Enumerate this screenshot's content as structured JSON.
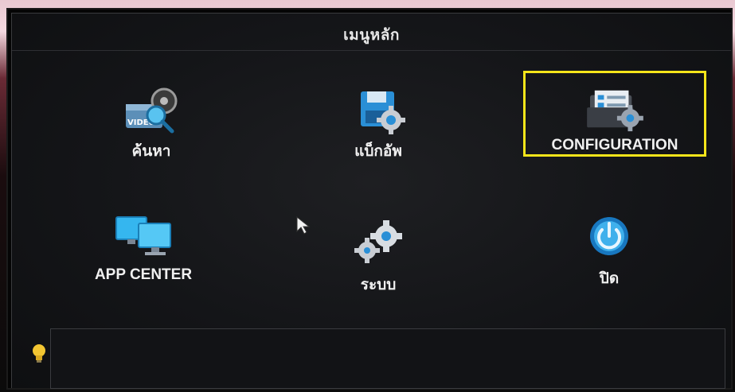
{
  "window": {
    "title": "เมนูหลัก"
  },
  "menu": {
    "items": [
      {
        "id": "search",
        "label": "ค้นหา",
        "icon": "video-search-icon"
      },
      {
        "id": "backup",
        "label": "แบ็กอัพ",
        "icon": "backup-gear-icon"
      },
      {
        "id": "configuration",
        "label": "CONFIGURATION",
        "icon": "folder-settings-icon",
        "selected": true
      },
      {
        "id": "app-center",
        "label": "APP CENTER",
        "icon": "monitors-icon"
      },
      {
        "id": "system",
        "label": "ระบบ",
        "icon": "gears-icon"
      },
      {
        "id": "shutdown",
        "label": "ปิด",
        "icon": "power-icon"
      }
    ]
  },
  "hint": {
    "icon": "lightbulb-icon",
    "text": ""
  },
  "colors": {
    "highlight": "#f5e51a",
    "icon_blue": "#2aa0e6",
    "gear_gray": "#c9cdd3"
  }
}
